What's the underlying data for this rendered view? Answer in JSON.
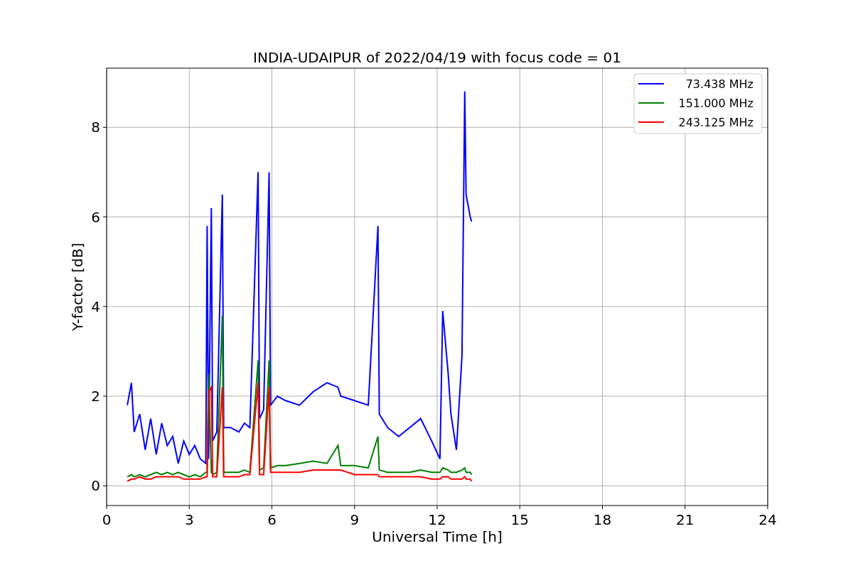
{
  "figure": {
    "chart_data": {
      "type": "line",
      "title": "INDIA-UDAIPUR of 2022/04/19 with focus code = 01",
      "xlabel": "Universal Time [h]",
      "ylabel": "Y-factor [dB]",
      "x": [
        0.75,
        0.9,
        1.0,
        1.2,
        1.4,
        1.6,
        1.8,
        2.0,
        2.2,
        2.4,
        2.6,
        2.8,
        3.0,
        3.2,
        3.4,
        3.6,
        3.65,
        3.7,
        3.8,
        3.85,
        4.0,
        4.2,
        4.25,
        4.5,
        4.8,
        5.0,
        5.2,
        5.5,
        5.55,
        5.7,
        5.9,
        5.95,
        6.2,
        6.5,
        7.0,
        7.5,
        8.0,
        8.4,
        8.5,
        9.0,
        9.5,
        9.85,
        9.9,
        10.2,
        10.6,
        11.0,
        11.4,
        11.8,
        12.1,
        12.2,
        12.4,
        12.5,
        12.7,
        12.9,
        13.0,
        13.05,
        13.2,
        13.25
      ],
      "series": [
        {
          "name": "73.438 MHz",
          "color": "#0000ff",
          "values": [
            1.8,
            2.3,
            1.2,
            1.6,
            0.8,
            1.5,
            0.7,
            1.4,
            0.9,
            1.1,
            0.5,
            1.0,
            0.7,
            0.9,
            0.6,
            0.5,
            5.8,
            0.6,
            6.2,
            1.0,
            1.2,
            6.5,
            1.3,
            1.3,
            1.2,
            1.4,
            1.3,
            7.0,
            1.5,
            1.7,
            7.0,
            1.8,
            2.0,
            1.9,
            1.8,
            2.1,
            2.3,
            2.2,
            2.0,
            1.9,
            1.8,
            5.8,
            1.6,
            1.3,
            1.1,
            1.3,
            1.5,
            1.0,
            0.6,
            3.9,
            2.5,
            1.6,
            0.8,
            2.9,
            8.8,
            6.5,
            6.0,
            5.9
          ]
        },
        {
          "name": "151.000 MHz",
          "color": "#008000",
          "values": [
            0.2,
            0.25,
            0.2,
            0.25,
            0.2,
            0.25,
            0.3,
            0.25,
            0.3,
            0.25,
            0.3,
            0.25,
            0.2,
            0.25,
            0.2,
            0.3,
            0.3,
            2.5,
            0.3,
            0.25,
            0.3,
            3.8,
            0.3,
            0.3,
            0.3,
            0.35,
            0.3,
            2.8,
            0.35,
            0.4,
            2.8,
            0.4,
            0.45,
            0.45,
            0.5,
            0.55,
            0.5,
            0.9,
            0.45,
            0.45,
            0.4,
            1.1,
            0.35,
            0.3,
            0.3,
            0.3,
            0.35,
            0.3,
            0.3,
            0.4,
            0.35,
            0.3,
            0.3,
            0.35,
            0.4,
            0.3,
            0.3,
            0.25
          ]
        },
        {
          "name": "243.125 MHz",
          "color": "#ff0000",
          "values": [
            0.1,
            0.15,
            0.15,
            0.2,
            0.15,
            0.15,
            0.2,
            0.2,
            0.2,
            0.2,
            0.2,
            0.15,
            0.15,
            0.15,
            0.15,
            0.2,
            0.2,
            2.1,
            2.2,
            0.2,
            0.2,
            2.2,
            0.2,
            0.2,
            0.2,
            0.25,
            0.25,
            2.3,
            0.25,
            0.25,
            2.2,
            0.3,
            0.3,
            0.3,
            0.3,
            0.35,
            0.35,
            0.35,
            0.35,
            0.25,
            0.25,
            0.25,
            0.2,
            0.2,
            0.2,
            0.2,
            0.2,
            0.15,
            0.15,
            0.2,
            0.2,
            0.15,
            0.15,
            0.15,
            0.2,
            0.15,
            0.15,
            0.1
          ]
        }
      ],
      "grid": true,
      "legend": true,
      "xlim": [
        0,
        24
      ],
      "ylim": [
        -0.44,
        9.32
      ],
      "xticks": [
        0,
        3,
        6,
        9,
        12,
        15,
        18,
        21,
        24
      ],
      "yticks": [
        0,
        2,
        4,
        6,
        8
      ]
    }
  }
}
